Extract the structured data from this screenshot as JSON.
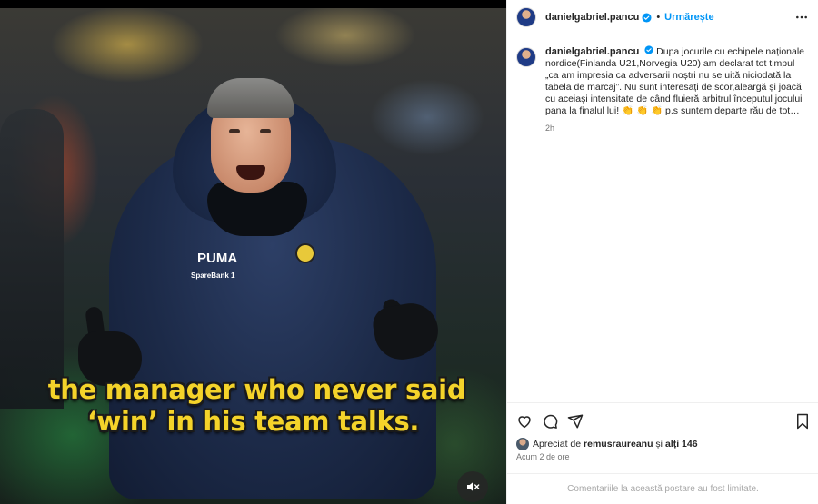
{
  "media": {
    "caption_line1": "the manager who never said",
    "caption_line2": "‘win’ in his team talks.",
    "jacket_brand": "PUMA",
    "jacket_sponsor": "SpareBank 1",
    "mute_icon": "speaker-muted-icon"
  },
  "header": {
    "username": "danielgabriel.pancu",
    "separator": "•",
    "follow_label": "Urmărește",
    "verified_icon": "verified-badge-icon",
    "more_icon": "more-options-icon"
  },
  "post": {
    "author": "danielgabriel.pancu",
    "text": "Dupa jocurile cu echipele naționale nordice(Finlanda U21,Norvegia U20) am declarat tot timpul „ca am impresia ca adversarii noștri nu se uită niciodată la tabela de marcaj”. Nu sunt interesați de scor,aleargă și joacă cu aceiași intensitate de când fluieră arbitrul începutul jocului pana la finalul lui! 👏 👏 👏 p.s suntem departe rău de tot…",
    "time": "2h"
  },
  "actions": {
    "like_icon": "heart-icon",
    "comment_icon": "comment-icon",
    "share_icon": "share-icon",
    "save_icon": "bookmark-icon"
  },
  "likes": {
    "prefix": "Apreciat de",
    "user": "remusraureanu",
    "conjunction": "și",
    "others": "alți 146"
  },
  "posted_ago": "Acum 2 de ore",
  "comments_limited": "Comentariile la această postare au fost limitate.",
  "colors": {
    "accent": "#0095f6",
    "caption": "#f4d32a",
    "muted_text": "#737373"
  }
}
